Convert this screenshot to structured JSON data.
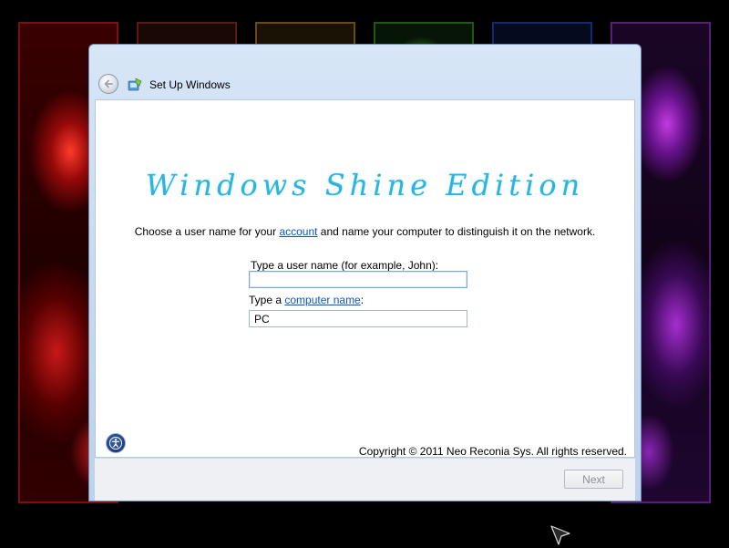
{
  "window": {
    "title": "Set Up Windows"
  },
  "content": {
    "brand_title": "Windows Shine Edition",
    "instruction": {
      "part1": "Choose a user name for your ",
      "link1": "account",
      "part2": " and name your computer to distinguish it on the network."
    },
    "username": {
      "label": "Type a user name (for example, John):",
      "value": ""
    },
    "computer_name": {
      "label_prefix": "Type a ",
      "label_link": "computer name",
      "label_suffix": ":",
      "value": "PC"
    },
    "copyright": "Copyright © 2011 Neo Reconia Sys.  All rights reserved."
  },
  "footer": {
    "next_label": "Next"
  },
  "colors": {
    "brand": "#2cb3e0",
    "link": "#0a56c9",
    "titlebar": "#c4d8ef"
  },
  "icons": {
    "back": "back-arrow-icon",
    "app": "setup-windows-icon",
    "ease_of_access": "ease-of-access-icon",
    "cursor": "mouse-pointer-icon"
  }
}
